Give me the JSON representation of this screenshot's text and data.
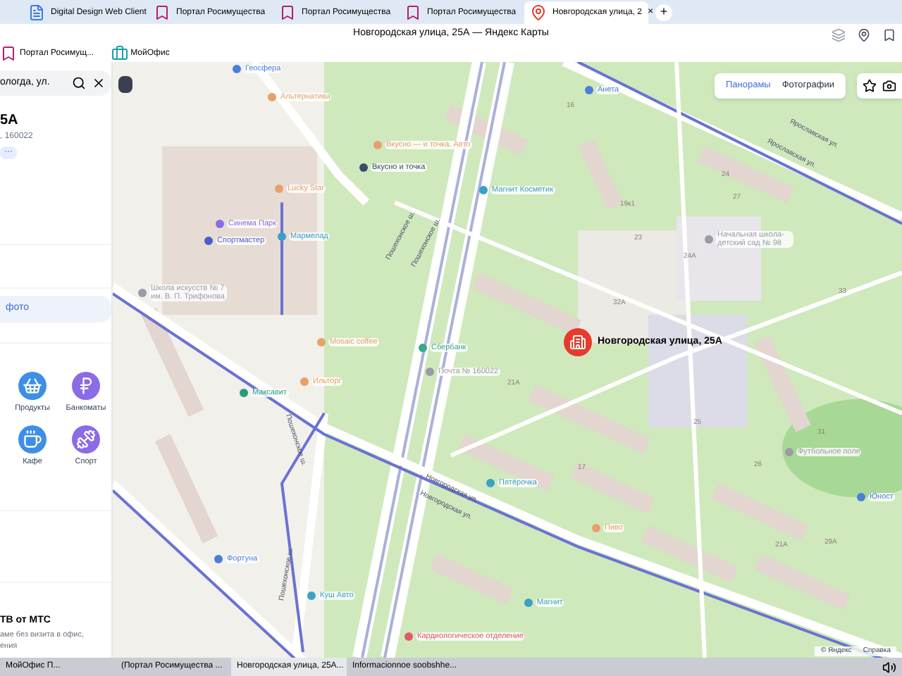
{
  "browser": {
    "tabs": [
      {
        "label": "Digital Design Web Client",
        "selected": false,
        "kind": "doc"
      },
      {
        "label": "Портал Росимущества",
        "selected": false,
        "kind": "portal"
      },
      {
        "label": "Портал Росимущества",
        "selected": false,
        "kind": "portal"
      },
      {
        "label": "Портал Росимущества",
        "selected": false,
        "kind": "portal"
      },
      {
        "label": "Новгородская улица, 2",
        "selected": true,
        "kind": "map"
      }
    ],
    "close": "×",
    "new_tab": "+",
    "title": "Новгородская улица, 25А — Яндекс Карты",
    "bookmarks": [
      {
        "label": "Портал Росимущ...",
        "kind": "portal"
      },
      {
        "label": "МойОфис",
        "kind": "office"
      }
    ]
  },
  "panel": {
    "search": {
      "value": "ологда, ул."
    },
    "title": "5А",
    "subtitle": ", 160022",
    "more": "···",
    "photo_button": "фото",
    "categories": [
      {
        "label": "Продукты",
        "color": "#3d8fe6",
        "kind": "basket"
      },
      {
        "label": "Банкоматы",
        "color": "#8b6be6",
        "kind": "ruble"
      },
      {
        "label": "Кафе",
        "color": "#3d8fe6",
        "kind": "cup"
      },
      {
        "label": "Спорт",
        "color": "#8b6be6",
        "kind": "dumbbell"
      }
    ],
    "promo": {
      "title": "ТВ от МТС",
      "line_1": "аме без визита в офис,",
      "line_2": "ения"
    }
  },
  "map": {
    "controls": [
      "Панорамы",
      "Фотографии"
    ],
    "target": {
      "label": "Новгородская улица, 25А"
    },
    "pois": [
      {
        "label": "Геосфера",
        "color": "#4a7fd8"
      },
      {
        "label": "Альтернатива",
        "color": "#e8a06a"
      },
      {
        "label": "Вкусно — и точка. Авто",
        "color": "#e8a06a"
      },
      {
        "label": "Вкусно и точка",
        "color": "#3a4a6a"
      },
      {
        "label": "Lucky Star",
        "color": "#e8a06a"
      },
      {
        "label": "Синема Парк",
        "color": "#8b6be6"
      },
      {
        "label": "Спортмастер",
        "color": "#4a5ec8"
      },
      {
        "label": "Мармелад",
        "color": "#3aa0c8"
      },
      {
        "label": "Магнит Косметик",
        "color": "#3aa0c8"
      },
      {
        "label": "Анета",
        "color": "#4a7fd8"
      },
      {
        "label": "Школа искусств № 7 им. В. П. Трифонова",
        "color": "#9a9aa8"
      },
      {
        "label": "Начальная школа-детский сад № 98",
        "color": "#9a9aa8"
      },
      {
        "label": "Сбербанк",
        "color": "#3aa88a"
      },
      {
        "label": "Почта № 160022",
        "color": "#9a9aa8"
      },
      {
        "label": "Mosaic coffee",
        "color": "#e8a06a"
      },
      {
        "label": "Ильторг",
        "color": "#e8a06a"
      },
      {
        "label": "Максавит",
        "color": "#2a9a7a"
      },
      {
        "label": "Пятёрочка",
        "color": "#3aa0c8"
      },
      {
        "label": "Пиво",
        "color": "#e8a06a"
      },
      {
        "label": "Фортуна",
        "color": "#4a7fd8"
      },
      {
        "label": "Куш Авто",
        "color": "#3aa0c8"
      },
      {
        "label": "Магнит",
        "color": "#3aa0c8"
      },
      {
        "label": "Кардиологическое отделение",
        "color": "#e05a6a"
      },
      {
        "label": "Футбольное поле",
        "color": "#9a9aa8"
      },
      {
        "label": "Юност",
        "color": "#4a7fd8"
      }
    ],
    "streets": [
      "Ярославская ул.",
      "Ярославская ул.",
      "Пошехонское ш.",
      "Пошехонское ш.",
      "Пошехонское ш.",
      "Пошехонское ш.",
      "Новгородская ул.",
      "Новгородская ул."
    ],
    "house_numbers": [
      "16",
      "24",
      "27",
      "19к1",
      "23",
      "32А",
      "24А",
      "33",
      "21А",
      "25",
      "31",
      "17",
      "26",
      "21А",
      "29А"
    ],
    "attribution": [
      "© Яндекс",
      "Справка"
    ]
  },
  "taskbar": [
    {
      "label": "МойОфис П...",
      "selected": false
    },
    {
      "label": "(Портал Росимущества ...",
      "selected": false
    },
    {
      "label": "Новгородская улица, 25А...",
      "selected": true
    },
    {
      "label": "Informacionnoe soobshhe...",
      "selected": false
    }
  ]
}
